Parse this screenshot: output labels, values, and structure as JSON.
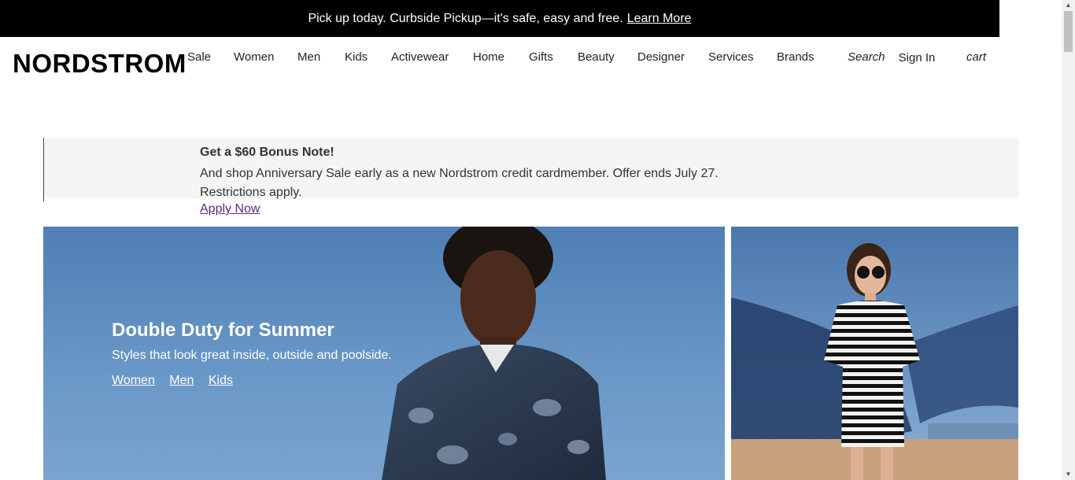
{
  "promo": {
    "text": "Pick up today. Curbside Pickup—it's safe, easy and free.",
    "link": "Learn More"
  },
  "header": {
    "logo": "NORDSTROM",
    "nav": [
      "Sale",
      "Women",
      "Men",
      "Kids",
      "Activewear",
      "Home",
      "Gifts",
      "Beauty",
      "Designer",
      "Services",
      "Brands"
    ],
    "search": "Search",
    "sign_in": "Sign In",
    "cart": "cart"
  },
  "card_offer": {
    "title": "Get a $60 Bonus Note!",
    "text": "And shop Anniversary Sale early as a new Nordstrom credit cardmember. Offer ends July 27. Restrictions apply.",
    "cta": "Apply Now"
  },
  "hero": {
    "title": "Double Duty for Summer",
    "subtitle": "Styles that look great inside, outside and poolside.",
    "links": [
      "Women",
      "Men",
      "Kids"
    ]
  },
  "colors": {
    "promo_bg": "#000000",
    "banner_bg": "#f5f5f5",
    "apply_link": "#5b2a86",
    "sky": "#5a88bc"
  }
}
